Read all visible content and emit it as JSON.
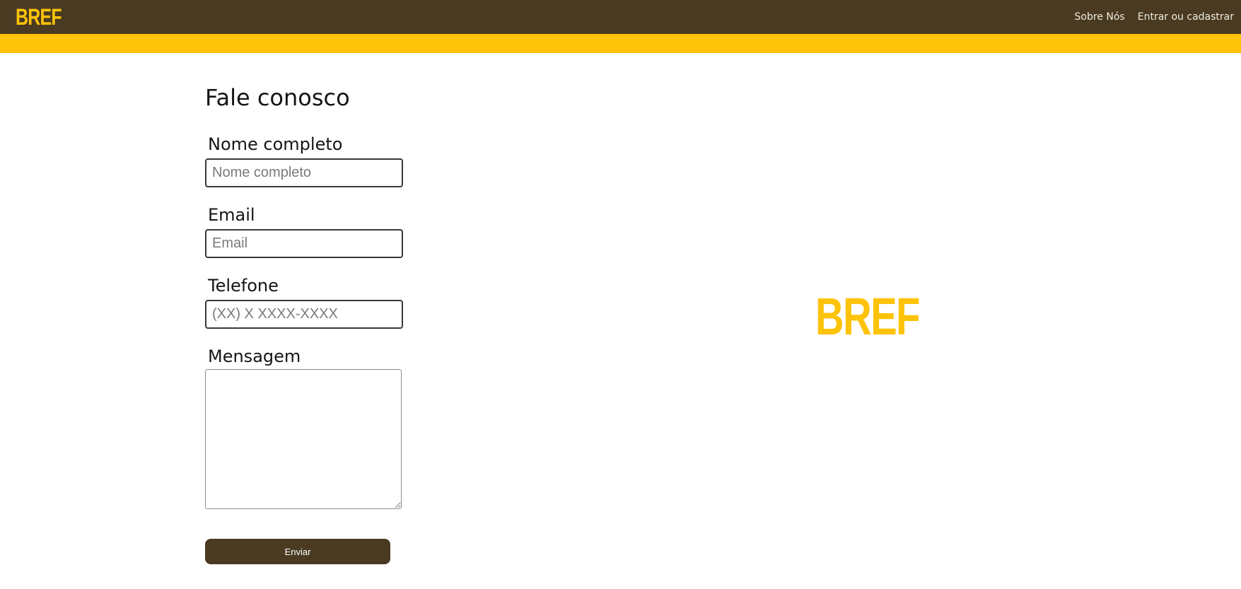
{
  "header": {
    "logo": "BREF",
    "nav": {
      "about": "Sobre Nós",
      "login": "Entrar ou cadastrar"
    }
  },
  "form": {
    "title": "Fale conosco",
    "fields": {
      "name": {
        "label": "Nome completo",
        "placeholder": "Nome completo",
        "value": ""
      },
      "email": {
        "label": "Email",
        "placeholder": "Email",
        "value": ""
      },
      "phone": {
        "label": "Telefone",
        "placeholder": "(XX) X XXXX-XXXX",
        "value": ""
      },
      "message": {
        "label": "Mensagem",
        "value": ""
      }
    },
    "submit_label": "Enviar"
  },
  "brand": {
    "logo": "BREF"
  },
  "colors": {
    "header_bg": "#493a21",
    "accent": "#fdc309",
    "button_bg": "#493a21"
  }
}
